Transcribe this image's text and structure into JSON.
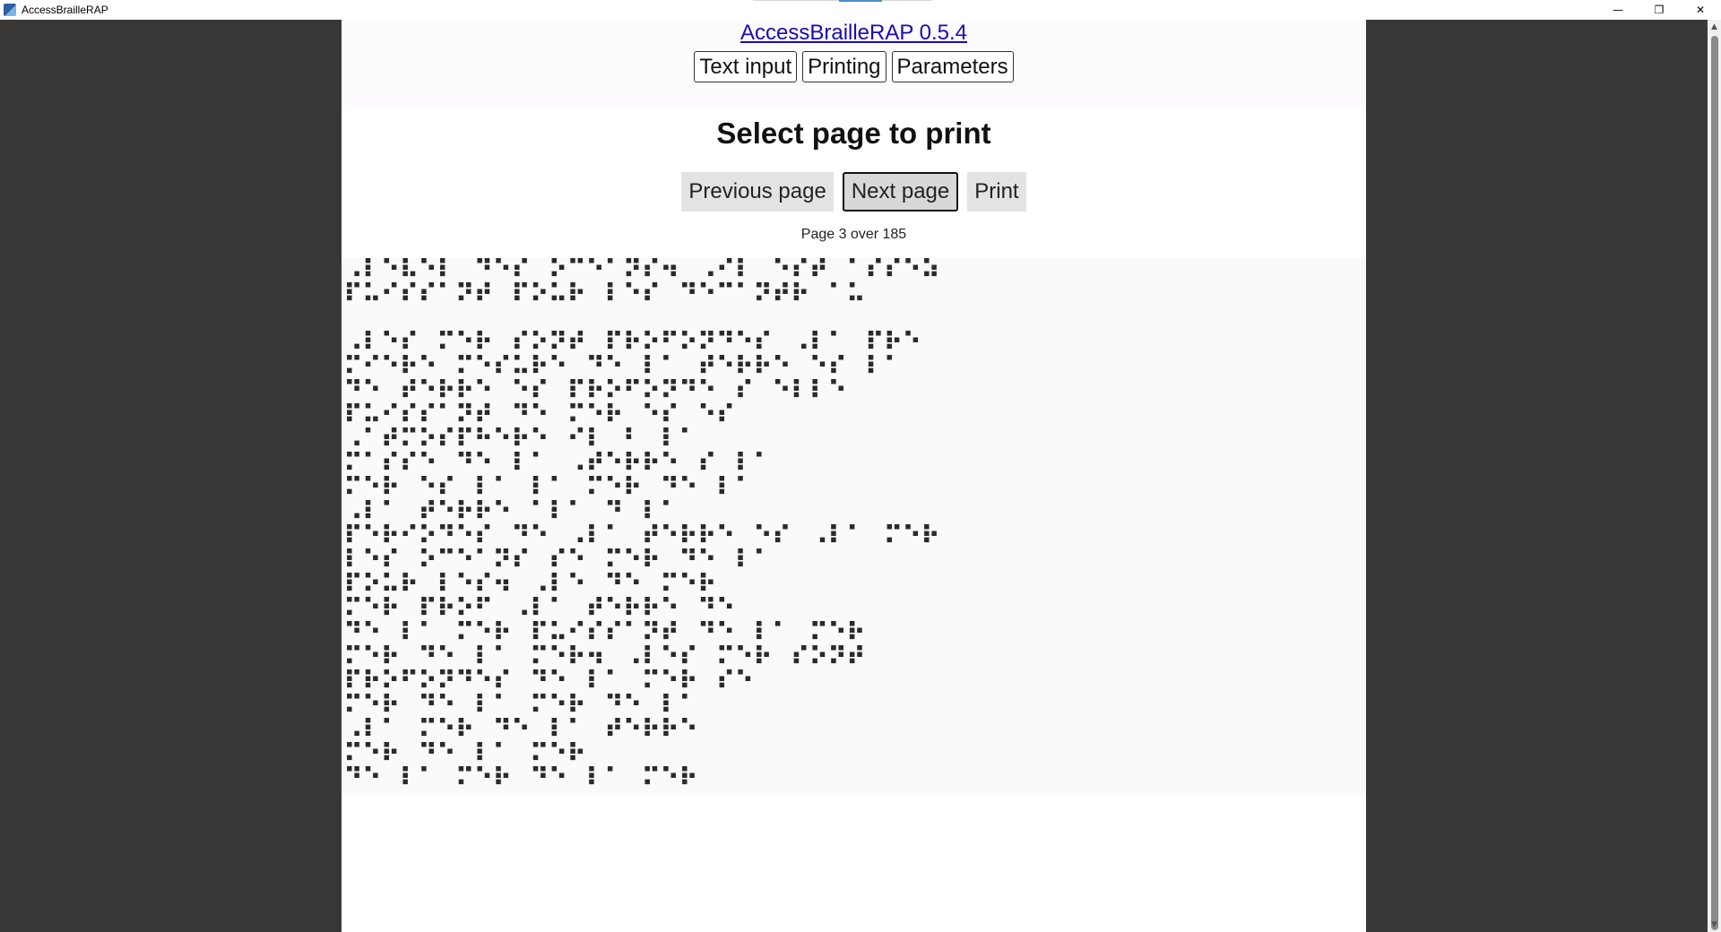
{
  "window": {
    "title": "AccessBrailleRAP",
    "minimize_icon": "—",
    "restore_icon": "❐",
    "close_icon": "✕"
  },
  "header": {
    "app_title": "AccessBrailleRAP 0.5.4",
    "nav": [
      "Text input",
      "Printing",
      "Parameters"
    ]
  },
  "main": {
    "page_title": "Select page to print",
    "buttons": {
      "previous": "Previous page",
      "next": "Next page",
      "print": "Print"
    },
    "status": "Page 3 over 185",
    "braille_lines": [
      "⠠⠇⠑⠧⠑⠇⠀⠙⠑⠎⠀⠕⠉⠑⠁⠝⠎⠲⠀⠠⠊⠇⠀⠑⠎⠞⠀⠁⠎⠎⠑⠵",
      "⠏⠥⠊⠎⠎⠁⠝⠞⠀⠏⠕⠥⠗⠀⠇⠑⠎⠀⠙⠑⠉⠁⠝⠞⠗⠀⠁⠥",
      "",
      "⠠⠇⠑⠎⠀⠍⠑⠗⠀⠎⠕⠝⠞⠀⠏⠗⠕⠋⠕⠝⠙⠑⠎⠀⠠⠇⠁⠀⠏⠗⠑",
      "⠍⠊⠑⠗⠑⠀⠍⠑⠎⠥⠗⠑⠀⠙⠑⠀⠇⠁⠀⠞⠑⠗⠗⠑⠀⠑⠎⠀⠇⠁",
      "⠙⠑⠀⠞⠑⠗⠗⠑⠀⠑⠎⠀⠏⠗⠕⠋⠕⠝⠙⠑⠀⠎⠀⠑⠇⠇⠑",
      "⠏⠥⠊⠎⠎⠁⠝⠞⠀⠙⠑⠀⠍⠑⠗⠀⠑⠎⠀⠑⠎",
      "⠠⠁⠞⠍⠕⠎⠏⠓⠑⠗⠑⠀⠊⠇⠀⠃⠀⠇⠁",
      "⠍⠁⠎⠎⠑⠀⠙⠑⠀⠇⠁⠀⠠⠞⠑⠗⠗⠑⠀⠎⠀⠇⠁",
      "⠍⠑⠗⠀⠑⠎⠀⠇⠁⠀⠇⠁⠀⠍⠑⠗⠀⠙⠑⠀⠇⠁",
      "⠠⠇⠁⠀⠞⠑⠗⠗⠑⠀⠁⠇⠁⠀⠙⠀⠇⠁",
      "⠏⠑⠗⠊⠕⠙⠑⠎⠀⠙⠑⠀⠠⠇⠁⠀⠞⠑⠗⠗⠑⠀⠑⠎⠀⠠⠇⠁⠀⠍⠑⠗",
      "⠇⠑⠎⠀⠕⠉⠑⠁⠝⠎⠀⠎⠑⠀⠍⠑⠗⠀⠙⠑⠀⠇⠁",
      "⠏⠕⠥⠗⠀⠇⠑⠎⠲⠀⠠⠇⠑⠀⠙⠑⠀⠍⠑⠗",
      "⠍⠑⠗⠀⠏⠗⠕⠋⠀⠠⠇⠁⠀⠞⠑⠗⠗⠑⠀⠙⠑",
      "⠙⠑⠀⠇⠁⠀⠍⠑⠗⠀⠏⠥⠊⠎⠎⠁⠝⠞⠀⠙⠑⠀⠇⠁⠀⠍⠑⠗",
      "⠍⠑⠗⠀⠙⠑⠀⠇⠁⠀⠍⠑⠗⠲⠀⠠⠇⠑⠎⠀⠍⠑⠗⠀⠎⠕⠝⠞",
      "⠏⠗⠕⠋⠕⠝⠙⠑⠎⠀⠙⠑⠀⠇⠁⠀⠍⠑⠗⠀⠎⠑",
      "⠍⠑⠗⠀⠙⠑⠀⠇⠁⠀⠍⠑⠗⠀⠙⠑⠀⠇⠁",
      "⠠⠇⠁⠀⠍⠑⠗⠀⠙⠑⠀⠇⠁⠀⠞⠑⠗⠗⠑",
      "⠍⠑⠗⠀⠙⠑⠀⠇⠁⠀⠍⠑⠗",
      "⠙⠑⠀⠇⠁⠀⠍⠑⠗⠀⠙⠑⠀⠇⠁⠀⠍⠑⠗"
    ]
  }
}
